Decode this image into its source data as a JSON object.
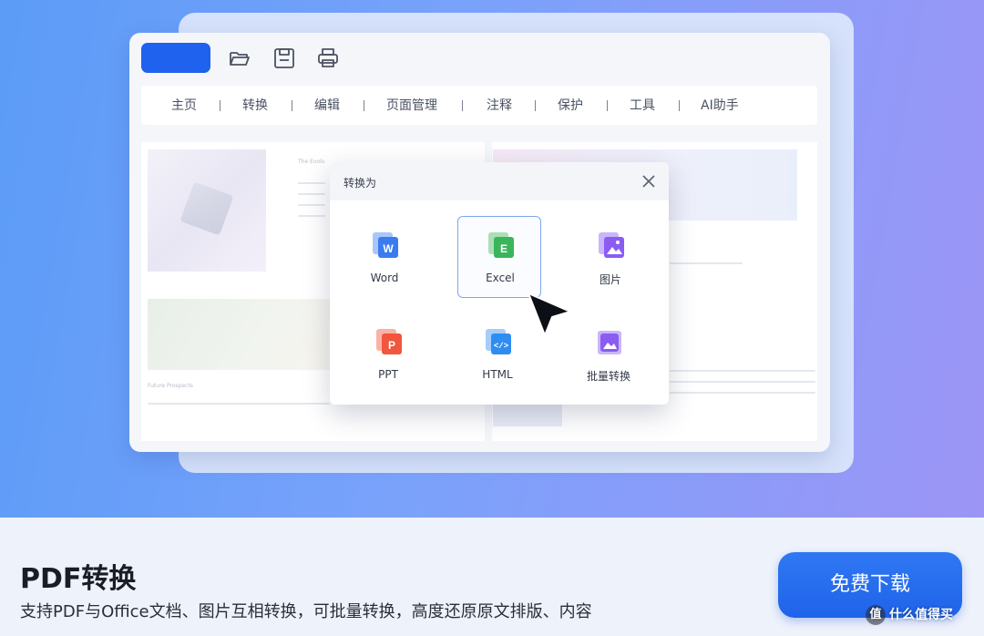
{
  "toolbar": {
    "icons": [
      "folder-open-icon",
      "save-icon",
      "print-icon"
    ]
  },
  "menu": {
    "items": [
      "主页",
      "转换",
      "编辑",
      "页面管理",
      "注释",
      "保护",
      "工具",
      "AI助手"
    ]
  },
  "document": {
    "snippets": [
      "The Evolu",
      "Future Prospects"
    ]
  },
  "dialog": {
    "title": "转换为",
    "options": [
      {
        "label": "Word",
        "icon": "word-icon",
        "color": "#3a7cf0"
      },
      {
        "label": "Excel",
        "icon": "excel-icon",
        "color": "#3bb55c",
        "selected": true
      },
      {
        "label": "图片",
        "icon": "image-icon",
        "color": "#8a5cf2"
      },
      {
        "label": "PPT",
        "icon": "ppt-icon",
        "color": "#f0573c"
      },
      {
        "label": "HTML",
        "icon": "html-icon",
        "color": "#2f8df2"
      },
      {
        "label": "批量转换",
        "icon": "batch-convert-icon",
        "color": "#8a5cf2"
      }
    ]
  },
  "promo": {
    "title": "PDF转换",
    "subtitle": "支持PDF与Office文档、图片互相转换，可批量转换，高度还原原文排版、内容",
    "button_label": "免费下载"
  },
  "watermark": {
    "icon_text": "值",
    "text": "什么值得买"
  },
  "colors": {
    "accent": "#1e62ee",
    "hero_start": "#5b9cf7",
    "hero_end": "#9c95f6"
  }
}
